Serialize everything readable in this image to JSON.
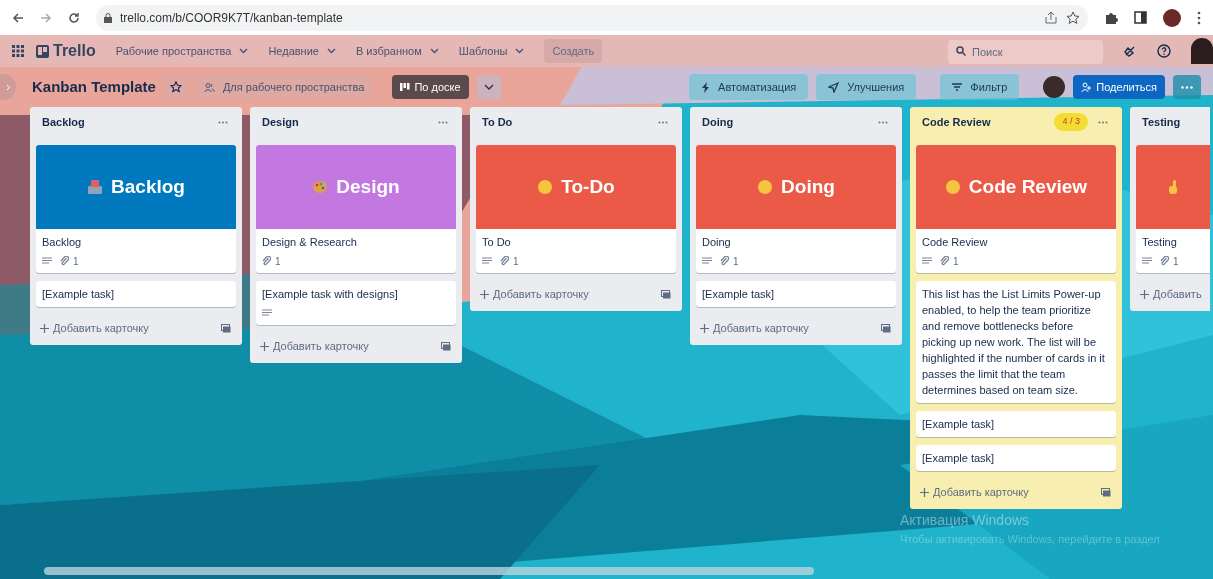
{
  "browser": {
    "url": "trello.com/b/COOR9K7T/kanban-template"
  },
  "header": {
    "logo": "Trello",
    "menus": [
      "Рабочие пространства",
      "Недавние",
      "В избранном",
      "Шаблоны"
    ],
    "create": "Создать",
    "search_placeholder": "Поиск"
  },
  "board": {
    "title": "Kanban Template",
    "starred": false,
    "visibility": "Для рабочего пространства",
    "view": "По доске",
    "actions": [
      "Автоматизация",
      "Улучшения",
      "Фильтр"
    ],
    "share": "Поделиться"
  },
  "lists": [
    {
      "title": "Backlog",
      "highlighted": false,
      "add_label": "Добавить карточку",
      "cards": [
        {
          "kind": "cover",
          "color": "#0079bf",
          "cover_title": "Backlog",
          "cover_icon": {
            "kind": "tray"
          },
          "title": "Backlog",
          "description": true,
          "attachments": "1"
        },
        {
          "kind": "plain",
          "title": "[Example task]",
          "description": false
        }
      ]
    },
    {
      "title": "Design",
      "highlighted": false,
      "add_label": "Добавить карточку",
      "cards": [
        {
          "kind": "cover",
          "color": "#c377e0",
          "cover_title": "Design",
          "cover_icon": {
            "kind": "palette"
          },
          "title": "Design & Research",
          "description": false,
          "attachments": "1"
        },
        {
          "kind": "plain",
          "title": "[Example task with designs]",
          "description": true
        }
      ]
    },
    {
      "title": "To Do",
      "highlighted": false,
      "add_label": "Добавить карточку",
      "cards": [
        {
          "kind": "cover",
          "color": "#eb5a46",
          "cover_title": "To-Do",
          "cover_icon": {
            "kind": "face"
          },
          "title": "To Do",
          "description": true,
          "attachments": "1"
        }
      ]
    },
    {
      "title": "Doing",
      "highlighted": false,
      "add_label": "Добавить карточку",
      "cards": [
        {
          "kind": "cover",
          "color": "#eb5a46",
          "cover_title": "Doing",
          "cover_icon": {
            "kind": "face"
          },
          "title": "Doing",
          "description": true,
          "attachments": "1"
        },
        {
          "kind": "plain",
          "title": "[Example task]",
          "description": false
        }
      ]
    },
    {
      "title": "Code Review",
      "highlighted": true,
      "limit": "4 / 3",
      "add_label": "Добавить карточку",
      "cards": [
        {
          "kind": "cover",
          "color": "#eb5a46",
          "cover_title": "Code Review",
          "cover_icon": {
            "kind": "face"
          },
          "title": "Code Review",
          "description": true,
          "attachments": "1"
        },
        {
          "kind": "plain",
          "title": "This list has the List Limits Power-up enabled, to help the team prioritize and remove bottlenecks before picking up new work. The list will be highlighted if the number of cards in it passes the limit that the team determines based on team size.",
          "description": false
        },
        {
          "kind": "plain",
          "title": "[Example task]",
          "description": false
        },
        {
          "kind": "plain",
          "title": "[Example task]",
          "description": false
        }
      ]
    },
    {
      "title": "Testing",
      "highlighted": false,
      "add_label": "Добавить",
      "cards": [
        {
          "kind": "cover",
          "color": "#eb5a46",
          "cover_icon": {
            "kind": "hand"
          },
          "title": "Testing",
          "description": true,
          "attachments": "1"
        }
      ]
    }
  ],
  "os_notice": {
    "title": "Активация Windows",
    "text": "Чтобы активировать Windows, перейдите в раздел"
  }
}
